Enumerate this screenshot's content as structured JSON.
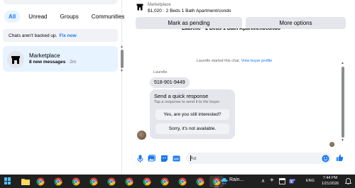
{
  "sidebar": {
    "filters": [
      "All",
      "Unread",
      "Groups",
      "Communities"
    ],
    "active_filter_index": 0,
    "banner": {
      "text": "Chats aren't backed up.",
      "link": "Fix now"
    },
    "chats": [
      {
        "name": "Marketplace",
        "subtitle": "8 new messages",
        "time": "· 2m",
        "icon": "storefront-icon"
      }
    ]
  },
  "conversation": {
    "header": {
      "title": "Marketplace",
      "subtitle": "$1,020 · 2 Beds 1 Bath Apartment/condo",
      "icon": "storefront-icon"
    },
    "actions": {
      "mark_pending": "Mark as pending",
      "more_options": "More options"
    },
    "listing_title_cut": "Laurelle · 2 Beds 1 Bath Apartment/condo",
    "system_message": {
      "text": "Laurelle started this chat.",
      "link": "View buyer profile"
    },
    "sender_name": "Laurelle",
    "messages": [
      {
        "text": "518-901-9449"
      }
    ],
    "quick_response": {
      "title": "Send a quick response",
      "subtitle": "Tap a response to send it to the buyer.",
      "options": [
        "Yes, are you still interested?",
        "Sorry, it's not available."
      ]
    },
    "composer": {
      "placeholder": "Aa"
    },
    "colors": {
      "accent": "#1877f2",
      "bubble": "#e4e6eb"
    }
  },
  "taskbar": {
    "apps": [
      "file-explorer-icon",
      "chrome-icon",
      "chrome-icon",
      "chrome-icon",
      "chrome-icon",
      "chrome-icon",
      "chrome-icon",
      "chrome-icon",
      "chrome-icon",
      "chrome-icon",
      "chrome-icon",
      "chrome-icon"
    ],
    "weather": "Rain...",
    "language": "ENG",
    "time": "7:44 PM",
    "date": "1/21/2026"
  }
}
